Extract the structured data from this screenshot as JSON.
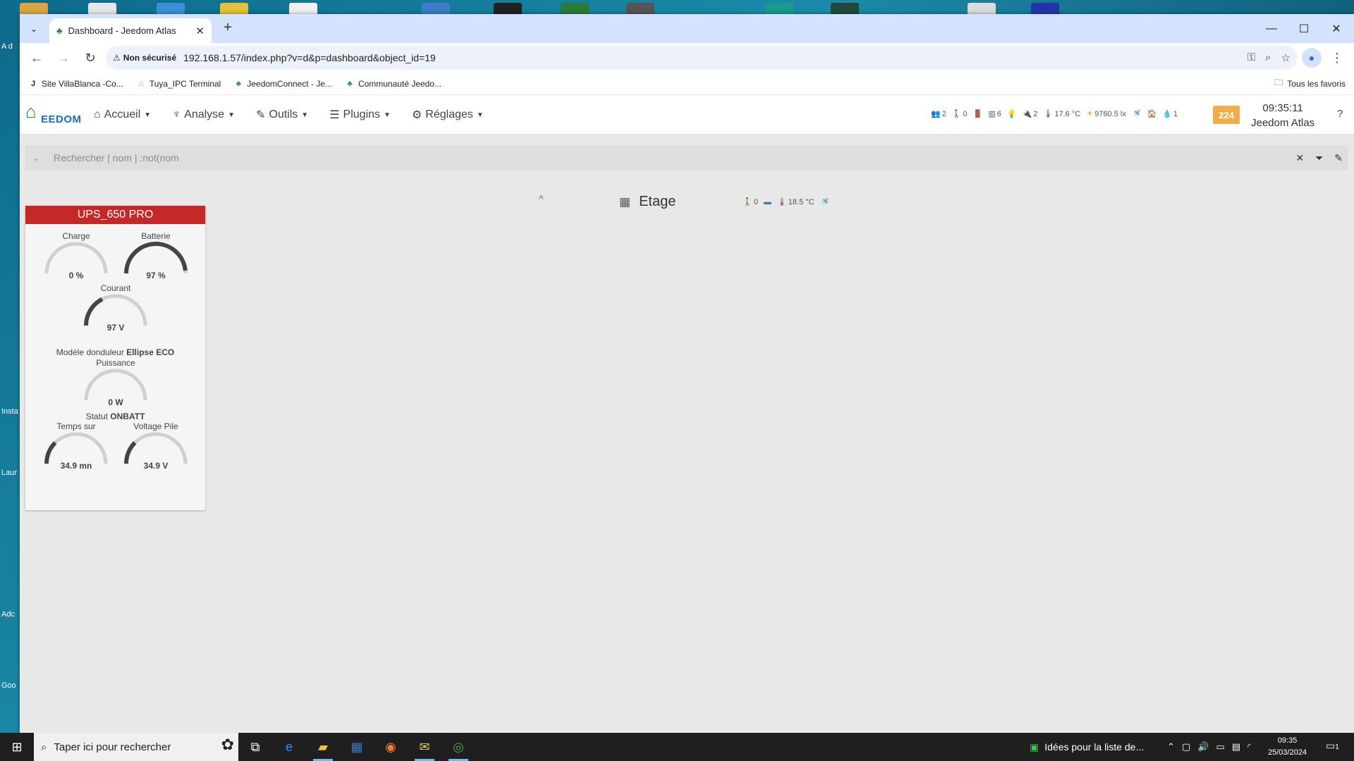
{
  "desktop": {
    "left_labels": [
      "A d",
      "Insta",
      "Laur Driv",
      "Adc",
      "Goo"
    ]
  },
  "browser": {
    "tab_title": "Dashboard - Jeedom Atlas",
    "tab_close": "✕",
    "new_tab": "+",
    "security_label": "Non sécurisé",
    "url": "192.168.1.57/index.php?v=d&p=dashboard&object_id=19",
    "bookmarks": [
      {
        "label": "Site VillaBlanca -Co...",
        "icon": "J"
      },
      {
        "label": "Tuya_IPC Terminal",
        "icon": "⌂"
      },
      {
        "label": "JeedomConnect - Je...",
        "icon": "♣"
      },
      {
        "label": "Communauté Jeedo...",
        "icon": "♣"
      }
    ],
    "all_bookmarks": "Tous les favoris"
  },
  "jeedom": {
    "logo_text": "EEDOM",
    "menu": [
      {
        "icon": "⌂",
        "label": "Accueil"
      },
      {
        "icon": "♆",
        "label": "Analyse"
      },
      {
        "icon": "✎",
        "label": "Outils"
      },
      {
        "icon": "☰",
        "label": "Plugins"
      },
      {
        "icon": "⚙",
        "label": "Réglages"
      }
    ],
    "summary": [
      {
        "icon": "👥",
        "value": "2"
      },
      {
        "icon": "🚶",
        "value": "0"
      },
      {
        "icon": "🚪",
        "value": ""
      },
      {
        "icon": "▥",
        "value": "6"
      },
      {
        "icon": "💡",
        "value": ""
      },
      {
        "icon": "🔌",
        "value": "2"
      },
      {
        "icon": "🌡",
        "value": "17.6 °C"
      },
      {
        "icon": "☀",
        "value": "9760.5 lx"
      },
      {
        "icon": "🚿",
        "value": ""
      },
      {
        "icon": "🏠",
        "value": ""
      },
      {
        "icon": "💧",
        "value": "1"
      }
    ],
    "badge": "224",
    "time": "09:35:11",
    "instance": "Jeedom Atlas",
    "help": "?",
    "search_placeholder": "Rechercher | nom | :not(nom",
    "object": {
      "name": "Etage",
      "collapse_icon": "^",
      "summary": [
        {
          "icon": "🚶",
          "value": "0"
        },
        {
          "icon": "▬",
          "value": ""
        },
        {
          "icon": "🌡",
          "value": "18.5 °C"
        },
        {
          "icon": "🚿",
          "value": ""
        }
      ]
    },
    "widget": {
      "title": "UPS_650 PRO",
      "gauges": {
        "charge": {
          "label": "Charge",
          "value": "0 %",
          "fraction": 0.0
        },
        "batterie": {
          "label": "Batterie",
          "value": "97 %",
          "fraction": 0.97
        },
        "courant": {
          "label": "Courant",
          "value": "97 V",
          "fraction": 0.35
        },
        "puissance": {
          "label": "Puissance",
          "value": "0 W",
          "fraction": 0.0
        },
        "temps": {
          "label": "Temps sur",
          "value": "34.9 mn",
          "fraction": 0.25
        },
        "voltage": {
          "label": "Voltage Pile",
          "value": "34.9 V",
          "fraction": 0.25
        }
      },
      "modele_label": "Modèle donduleur",
      "modele_value": "Ellipse ECO",
      "statut_label": "Statut",
      "statut_value": "ONBATT"
    }
  },
  "taskbar": {
    "search_placeholder": "Taper ici pour rechercher",
    "news": "Idées pour la liste de...",
    "time": "09:35",
    "date": "25/03/2024",
    "notif_count": "1"
  },
  "colors": {
    "widget_header": "#c62828",
    "badge": "#f0ad4e",
    "gauge_track": "#d0d0d0",
    "gauge_fill": "#444444"
  }
}
